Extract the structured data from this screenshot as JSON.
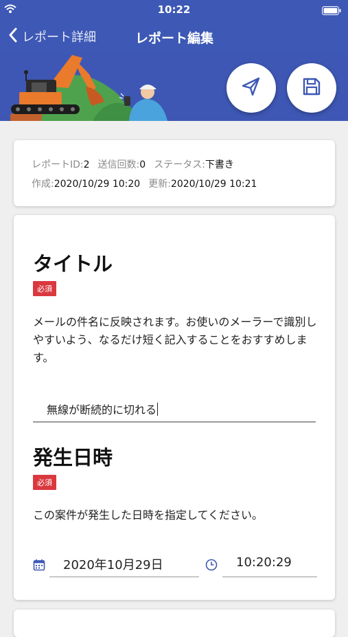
{
  "status_bar": {
    "time": "10:22"
  },
  "nav": {
    "back_label": "レポート詳細",
    "title": "レポート編集"
  },
  "banner": {
    "send_icon": "send-icon",
    "save_icon": "floppy-disk-icon"
  },
  "meta": {
    "report_id_label": "レポートID:",
    "report_id": "2",
    "send_count_label": "送信回数:",
    "send_count": "0",
    "status_label": "ステータス:",
    "status": "下書き",
    "created_label": "作成:",
    "created": "2020/10/29 10:20",
    "updated_label": "更新:",
    "updated": "2020/10/29 10:21"
  },
  "form": {
    "title_section": {
      "heading": "タイトル",
      "required": "必須",
      "help": "メールの件名に反映されます。お使いのメーラーで識別しやすいよう、なるだけ短く記入することをおすすめします。",
      "value": "無線が断続的に切れる"
    },
    "datetime_section": {
      "heading": "発生日時",
      "required": "必須",
      "help": "この案件が発生した日時を指定してください。",
      "date": "2020年10月29日",
      "time": "10:20:29",
      "date_icon": "calendar-icon",
      "time_icon": "clock-icon"
    }
  },
  "colors": {
    "primary": "#3d58b5",
    "required": "#d9393e",
    "background": "#efefef"
  }
}
